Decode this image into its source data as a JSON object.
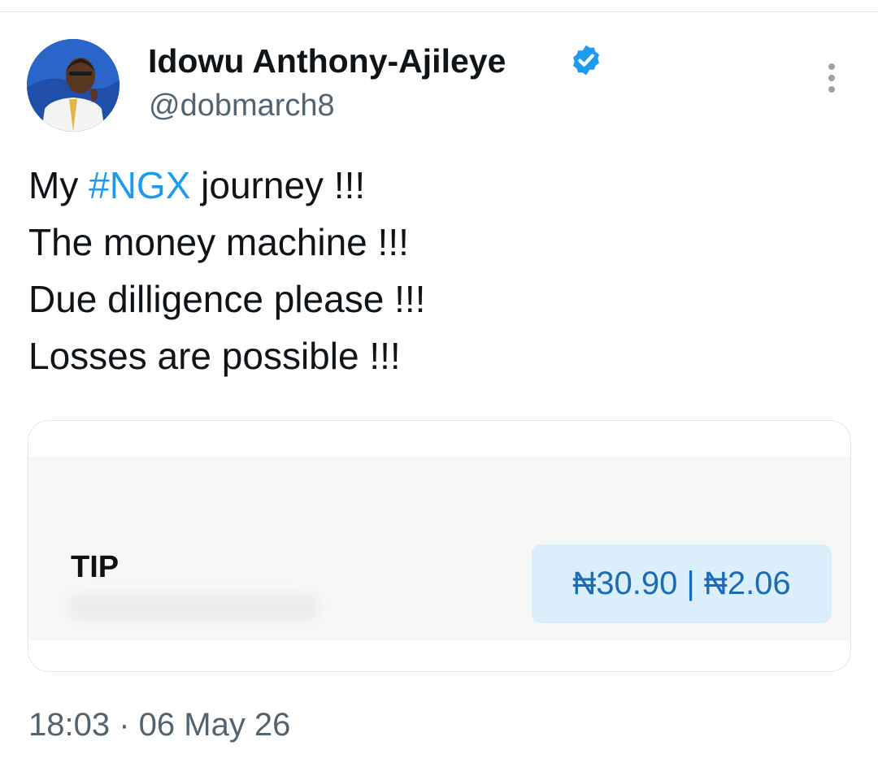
{
  "tweet": {
    "author_name": "Idowu Anthony-Ajileye",
    "author_handle": "@dobmarch8",
    "verified": true,
    "lines": [
      {
        "before": "My ",
        "hashtag": "#NGX",
        "after": " journey !!!"
      },
      {
        "text": "The money machine !!!"
      },
      {
        "text": "Due dilligence please !!!"
      },
      {
        "text": "Losses are possible !!!"
      }
    ],
    "timestamp": "18:03 · 06 May 26"
  },
  "card": {
    "label": "TIP",
    "price": "₦30.90 | ₦2.06"
  },
  "icons": {
    "verified": "verified-badge-icon",
    "more": "more-vertical-icon"
  },
  "colors": {
    "hashtag": "#1d9bf0",
    "verified": "#1d9bf0",
    "secondary_text": "#536471",
    "price_chip_bg": "#dbeefc",
    "price_text": "#1a6bb8"
  }
}
